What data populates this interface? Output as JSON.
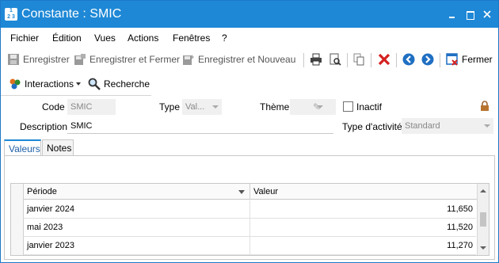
{
  "window": {
    "title": "Constante : SMIC",
    "app_icon_text": "1 2 3"
  },
  "menu": [
    "Fichier",
    "Édition",
    "Vues",
    "Actions",
    "Fenêtres",
    "?"
  ],
  "toolbar": {
    "save_label": "Enregistrer",
    "save_close_label": "Enregistrer et Fermer",
    "save_new_label": "Enregistrer et Nouveau",
    "close_label": "Fermer"
  },
  "toolbar2": {
    "interactions_label": "Interactions",
    "search_label": "Recherche"
  },
  "form": {
    "code_label": "Code",
    "code_value": "SMIC",
    "type_label": "Type",
    "type_value": "Val...",
    "theme_label": "Thème",
    "theme_value": "",
    "inactive_label": "Inactif",
    "inactive_checked": false,
    "description_label": "Description",
    "description_value": "SMIC",
    "activity_type_label": "Type d'activité",
    "activity_type_value": "Standard"
  },
  "tabs": [
    {
      "label": "Valeurs",
      "active": true
    },
    {
      "label": "Notes",
      "active": false
    }
  ],
  "grid": {
    "columns": [
      "Période",
      "Valeur"
    ],
    "rows": [
      {
        "period": "janvier 2024",
        "value": "11,650"
      },
      {
        "period": "mai 2023",
        "value": "11,520"
      },
      {
        "period": "janvier 2023",
        "value": "11,270"
      }
    ]
  },
  "colors": {
    "titlebar": "#1e88d6",
    "active_tab": "#1e5fa8",
    "delete_red": "#d42020",
    "nav_blue": "#1f6fc2"
  }
}
